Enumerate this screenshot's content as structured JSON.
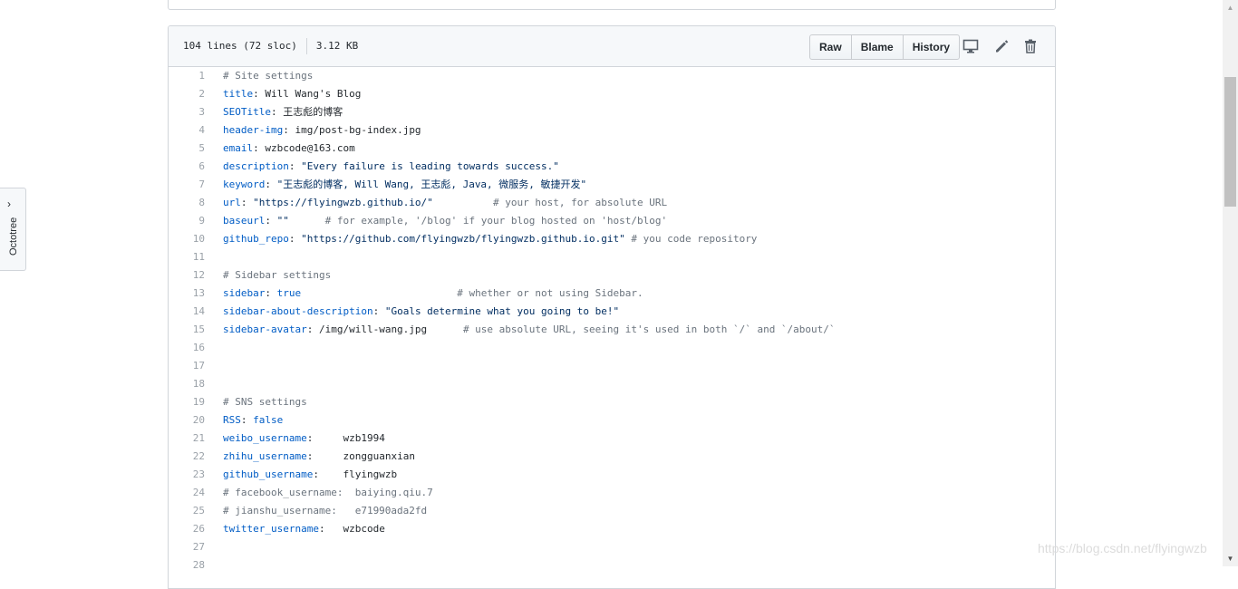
{
  "file_header": {
    "lines_info": "104 lines (72 sloc)",
    "size": "3.12 KB",
    "buttons": {
      "raw": "Raw",
      "blame": "Blame",
      "history": "History"
    }
  },
  "code": [
    {
      "n": "1",
      "t": [
        [
          "c",
          "# Site settings"
        ]
      ]
    },
    {
      "n": "2",
      "t": [
        [
          "k",
          "title"
        ],
        [
          "p",
          ": "
        ],
        [
          "v",
          "Will Wang's Blog"
        ]
      ]
    },
    {
      "n": "3",
      "t": [
        [
          "k",
          "SEOTitle"
        ],
        [
          "p",
          ": "
        ],
        [
          "v",
          "王志彪的博客"
        ]
      ]
    },
    {
      "n": "4",
      "t": [
        [
          "k",
          "header-img"
        ],
        [
          "p",
          ": "
        ],
        [
          "v",
          "img/post-bg-index.jpg"
        ]
      ]
    },
    {
      "n": "5",
      "t": [
        [
          "k",
          "email"
        ],
        [
          "p",
          ": "
        ],
        [
          "v",
          "wzbcode@163.com"
        ]
      ]
    },
    {
      "n": "6",
      "t": [
        [
          "k",
          "description"
        ],
        [
          "p",
          ": "
        ],
        [
          "s",
          "\"Every failure is leading towards success.\""
        ]
      ]
    },
    {
      "n": "7",
      "t": [
        [
          "k",
          "keyword"
        ],
        [
          "p",
          ": "
        ],
        [
          "s",
          "\"王志彪的博客, Will Wang, 王志彪, Java, 微服务, 敏捷开发\""
        ]
      ]
    },
    {
      "n": "8",
      "t": [
        [
          "k",
          "url"
        ],
        [
          "p",
          ": "
        ],
        [
          "s",
          "\"https://flyingwzb.github.io/\""
        ],
        [
          "p",
          "          "
        ],
        [
          "c",
          "# your host, for absolute URL"
        ]
      ]
    },
    {
      "n": "9",
      "t": [
        [
          "k",
          "baseurl"
        ],
        [
          "p",
          ": "
        ],
        [
          "s",
          "\"\""
        ],
        [
          "p",
          "      "
        ],
        [
          "c",
          "# for example, '/blog' if your blog hosted on 'host/blog'"
        ]
      ]
    },
    {
      "n": "10",
      "t": [
        [
          "k",
          "github_repo"
        ],
        [
          "p",
          ": "
        ],
        [
          "s",
          "\"https://github.com/flyingwzb/flyingwzb.github.io.git\""
        ],
        [
          "p",
          " "
        ],
        [
          "c",
          "# you code repository"
        ]
      ]
    },
    {
      "n": "11",
      "t": []
    },
    {
      "n": "12",
      "t": [
        [
          "c",
          "# Sidebar settings"
        ]
      ]
    },
    {
      "n": "13",
      "t": [
        [
          "k",
          "sidebar"
        ],
        [
          "p",
          ": "
        ],
        [
          "k",
          "true"
        ],
        [
          "p",
          "                          "
        ],
        [
          "c",
          "# whether or not using Sidebar."
        ]
      ]
    },
    {
      "n": "14",
      "t": [
        [
          "k",
          "sidebar-about-description"
        ],
        [
          "p",
          ": "
        ],
        [
          "s",
          "\"Goals determine what you going to be!\""
        ]
      ]
    },
    {
      "n": "15",
      "t": [
        [
          "k",
          "sidebar-avatar"
        ],
        [
          "p",
          ": "
        ],
        [
          "v",
          "/img/will-wang.jpg"
        ],
        [
          "p",
          "      "
        ],
        [
          "c",
          "# use absolute URL, seeing it's used in both `/` and `/about/`"
        ]
      ]
    },
    {
      "n": "16",
      "t": []
    },
    {
      "n": "17",
      "t": []
    },
    {
      "n": "18",
      "t": []
    },
    {
      "n": "19",
      "t": [
        [
          "c",
          "# SNS settings"
        ]
      ]
    },
    {
      "n": "20",
      "t": [
        [
          "k",
          "RSS"
        ],
        [
          "p",
          ": "
        ],
        [
          "k",
          "false"
        ]
      ]
    },
    {
      "n": "21",
      "t": [
        [
          "k",
          "weibo_username"
        ],
        [
          "p",
          ":     "
        ],
        [
          "v",
          "wzb1994"
        ]
      ]
    },
    {
      "n": "22",
      "t": [
        [
          "k",
          "zhihu_username"
        ],
        [
          "p",
          ":     "
        ],
        [
          "v",
          "zongguanxian"
        ]
      ]
    },
    {
      "n": "23",
      "t": [
        [
          "k",
          "github_username"
        ],
        [
          "p",
          ":    "
        ],
        [
          "v",
          "flyingwzb"
        ]
      ]
    },
    {
      "n": "24",
      "t": [
        [
          "c",
          "# facebook_username:  baiying.qiu.7"
        ]
      ]
    },
    {
      "n": "25",
      "t": [
        [
          "c",
          "# jianshu_username:   e71990ada2fd"
        ]
      ]
    },
    {
      "n": "26",
      "t": [
        [
          "k",
          "twitter_username"
        ],
        [
          "p",
          ":   "
        ],
        [
          "v",
          "wzbcode"
        ]
      ]
    },
    {
      "n": "27",
      "t": []
    },
    {
      "n": "28",
      "t": []
    }
  ],
  "octotree": {
    "label": "Octotree"
  },
  "watermark": "https://blog.csdn.net/flyingwzb"
}
